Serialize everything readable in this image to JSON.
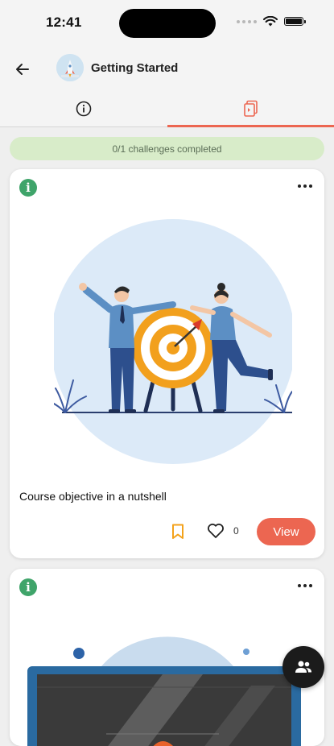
{
  "status_bar": {
    "time": "12:41",
    "icons": [
      "signal-dots-icon",
      "wifi-icon",
      "battery-icon"
    ]
  },
  "header": {
    "back_icon": "arrow-left-icon",
    "title": "Getting Started"
  },
  "tabs": [
    {
      "icon": "info-circle-icon",
      "active": false
    },
    {
      "icon": "cards-icon",
      "active": true
    }
  ],
  "progress": {
    "text": "0/1 challenges completed",
    "completed": 0,
    "total": 1
  },
  "cards": [
    {
      "title": "Course objective in a nutshell",
      "like_count": "0",
      "view_label": "View",
      "bookmark_icon": "bookmark-icon",
      "like_icon": "heart-icon",
      "more_icon": "more-horizontal-icon",
      "info_icon": "info-icon"
    },
    {
      "more_icon": "more-horizontal-icon",
      "info_icon": "info-icon"
    }
  ],
  "fab": {
    "icon": "community-icon"
  },
  "colors": {
    "accent": "#ec6651",
    "progress_bg": "#d8ecc9",
    "info_green": "#3fa46a",
    "bookmark": "#f3a21b",
    "illustration_bg": "#dceaf8"
  }
}
